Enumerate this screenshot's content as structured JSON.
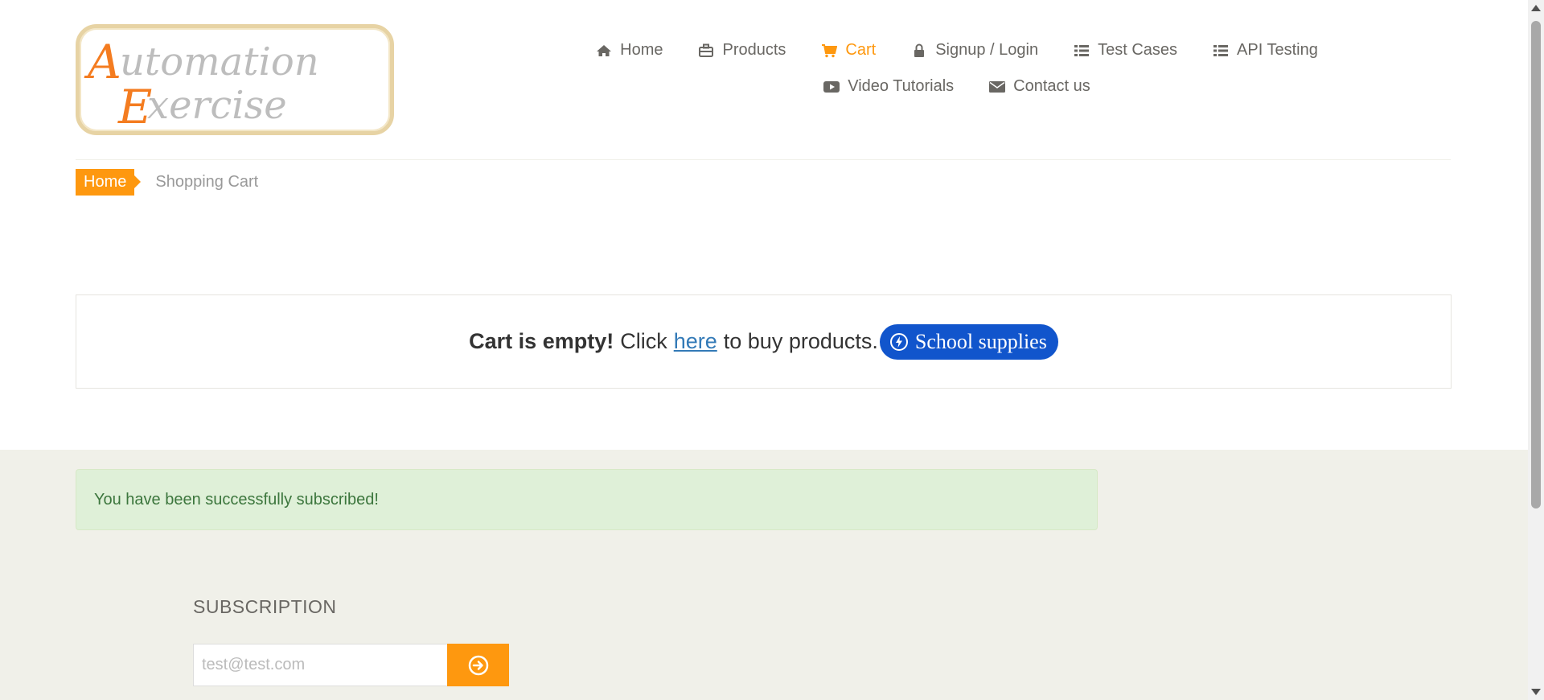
{
  "logo": {
    "line1": "utomation",
    "line2": "xercise",
    "cap1": "A",
    "cap2": "E"
  },
  "nav": {
    "row1": [
      {
        "label": "Home",
        "icon": "home-icon"
      },
      {
        "label": "Products",
        "icon": "briefcase-icon"
      },
      {
        "label": "Cart",
        "icon": "shopping-cart-icon",
        "active": true
      },
      {
        "label": "Signup / Login",
        "icon": "lock-icon"
      },
      {
        "label": "Test Cases",
        "icon": "list-icon"
      },
      {
        "label": "API Testing",
        "icon": "list-icon"
      }
    ],
    "row2": [
      {
        "label": "Video Tutorials",
        "icon": "youtube-play-icon"
      },
      {
        "label": "Contact us",
        "icon": "envelope-icon"
      }
    ]
  },
  "breadcrumb": {
    "home": "Home",
    "current": "Shopping Cart"
  },
  "cart": {
    "empty_bold": "Cart is empty!",
    "click": "Click",
    "link": "here",
    "rest": "to buy products.",
    "pill": "School supplies"
  },
  "footer": {
    "alert": "You have been successfully subscribed!",
    "subscription_title": "SUBSCRIPTION",
    "email_placeholder": "test@test.com"
  },
  "colors": {
    "accent": "#fe980f",
    "link": "#337ab7",
    "pill": "#1155cc",
    "footer_bg": "#f0f0e9",
    "alert_bg": "#dff0d8"
  }
}
